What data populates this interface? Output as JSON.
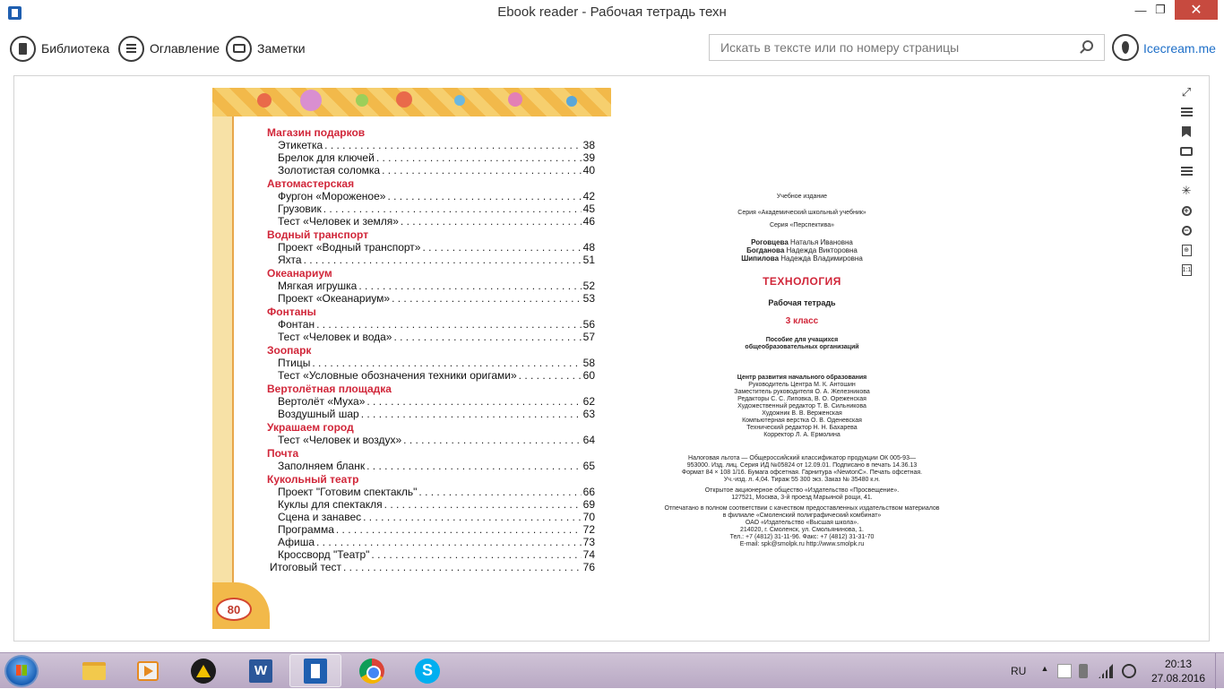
{
  "window": {
    "title": "Ebook reader - Рабочая тетрадь техн",
    "minimize_glyph": "—",
    "maximize_glyph": "❐",
    "close_glyph": "✕"
  },
  "toolbar": {
    "library_label": "Библиотека",
    "contents_label": "Оглавление",
    "notes_label": "Заметки",
    "search_placeholder": "Искать в тексте или по номеру страницы",
    "search_value": "",
    "brand_link": "Icecream.me"
  },
  "page_left": {
    "page_number": "80",
    "toc": [
      {
        "section": "Магазин подарков",
        "entries": [
          {
            "title": "Этикетка",
            "page": "38"
          },
          {
            "title": "Брелок для ключей",
            "page": "39"
          },
          {
            "title": "Золотистая соломка",
            "page": "40"
          }
        ]
      },
      {
        "section": "Автомастерская",
        "entries": [
          {
            "title": "Фургон «Мороженое»",
            "page": "42"
          },
          {
            "title": "Грузовик",
            "page": "45"
          },
          {
            "title": "Тест «Человек и земля»",
            "page": "46"
          }
        ]
      },
      {
        "section": "Водный транспорт",
        "entries": [
          {
            "title": "Проект «Водный транспорт»",
            "page": "48"
          },
          {
            "title": "Яхта",
            "page": "51"
          }
        ]
      },
      {
        "section": "Океанариум",
        "entries": [
          {
            "title": "Мягкая игрушка",
            "page": "52"
          },
          {
            "title": "Проект «Океанариум»",
            "page": "53"
          }
        ]
      },
      {
        "section": "Фонтаны",
        "entries": [
          {
            "title": "Фонтан",
            "page": "56"
          },
          {
            "title": "Тест «Человек и вода»",
            "page": "57"
          }
        ]
      },
      {
        "section": "Зоопарк",
        "entries": [
          {
            "title": "Птицы",
            "page": "58"
          },
          {
            "title": "Тест «Условные обозначения техники оригами»",
            "page": "60"
          }
        ]
      },
      {
        "section": "Вертолётная площадка",
        "entries": [
          {
            "title": "Вертолёт «Муха»",
            "page": "62"
          },
          {
            "title": "Воздушный шар",
            "page": "63"
          }
        ]
      },
      {
        "section": "Украшаем город",
        "entries": [
          {
            "title": "Тест «Человек и воздух»",
            "page": "64"
          }
        ]
      },
      {
        "section": "Почта",
        "entries": [
          {
            "title": "Заполняем бланк",
            "page": "65"
          }
        ]
      },
      {
        "section": "Кукольный театр",
        "entries": [
          {
            "title": "Проект \"Готовим спектакль\"",
            "page": "66"
          },
          {
            "title": "Куклы для спектакля",
            "page": "69"
          },
          {
            "title": "Сцена и занавес",
            "page": "70"
          },
          {
            "title": "Программа",
            "page": "72"
          },
          {
            "title": "Афиша",
            "page": "73"
          },
          {
            "title": "Кроссворд \"Театр\"",
            "page": "74"
          }
        ]
      }
    ],
    "final_entry": {
      "title": "Итоговый тест",
      "page": "76"
    }
  },
  "page_right": {
    "edition_type": "Учебное издание",
    "series_1": "Серия «Академический школьный учебник»",
    "series_2": "Серия «Перспектива»",
    "author_1_last": "Роговцева",
    "author_1_first": "Наталья Ивановна",
    "author_2_last": "Богданова",
    "author_2_first": "Надежда Викторовна",
    "author_3_last": "Шипилова",
    "author_3_first": "Надежда Владимировна",
    "book_title": "ТЕХНОЛОГИЯ",
    "book_subtitle": "Рабочая тетрадь",
    "grade": "3 класс",
    "purpose_1": "Пособие для учащихся",
    "purpose_2": "общеобразовательных организаций",
    "staff": [
      "Центр развития начального образования",
      "Руководитель Центра М. К. Антошин",
      "Заместитель руководителя О. А. Железникова",
      "Редакторы С. С. Липовка, В. О. Ореженская",
      "Художественный редактор Т. В. Сильникова",
      "Художник В. В. Верженская",
      "Компьютерная верстка О. В. Оденевская",
      "Технический редактор Н. Н. Бахарева",
      "Корректор Л. А. Ермолина"
    ],
    "legal": [
      "Налоговая льгота — Общероссийский классификатор продукции ОК 005-93—",
      "953000. Изд. лиц. Серия ИД №05824 от 12.09.01. Подписано в печать 14.36.13",
      "Формат 84 × 108 1/16. Бумага офсетная. Гарнитура «NewtonC». Печать офсетная.",
      "Уч.-изд. л. 4,04. Тираж 55 300 экз. Заказ № 35480 к.н.",
      "Открытое акционерное общество «Издательство «Просвещение».",
      "127521, Москва, 3-й проезд Марьиной рощи, 41.",
      "Отпечатано в полном соответствии с качеством предоставленных издательством материалов",
      "в филиале «Смоленский полиграфический комбинат»",
      "ОАО «Издательство «Высшая школа».",
      "214020, г. Смоленск, ул. Смольянинова, 1.",
      "Тел.: +7 (4812) 31-11-96. Факс: +7 (4812) 31-31-70",
      "E-mail: spk@smolpk.ru http://www.smolpk.ru"
    ]
  },
  "sidetools": [
    {
      "name": "fullscreen-icon",
      "glyph": "⤢"
    },
    {
      "name": "contents-list-icon",
      "glyph": ""
    },
    {
      "name": "bookmark-icon",
      "glyph": ""
    },
    {
      "name": "notes-icon",
      "glyph": ""
    },
    {
      "name": "page-view-icon",
      "glyph": ""
    },
    {
      "name": "brightness-icon",
      "glyph": "✳"
    },
    {
      "name": "zoom-in-icon",
      "glyph": "+"
    },
    {
      "name": "zoom-out-icon",
      "glyph": "−"
    },
    {
      "name": "fit-page-icon",
      "glyph": "⊕"
    },
    {
      "name": "actual-size-icon",
      "glyph": "1:1"
    }
  ],
  "taskbar": {
    "language": "RU",
    "time": "20:13",
    "date": "27.08.2016"
  },
  "colors": {
    "accent_red": "#d1273a",
    "link_blue": "#1e6fc8",
    "close_red": "#c74a3f",
    "banner_yellow": "#f2b94a"
  }
}
